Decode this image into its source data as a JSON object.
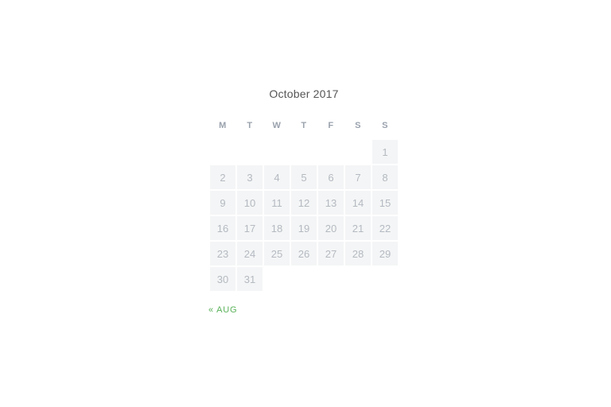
{
  "calendar": {
    "title": "October 2017",
    "weekdays": [
      "M",
      "T",
      "W",
      "T",
      "F",
      "S",
      "S"
    ],
    "grid": [
      [
        null,
        null,
        null,
        null,
        null,
        null,
        1
      ],
      [
        2,
        3,
        4,
        5,
        6,
        7,
        8
      ],
      [
        9,
        10,
        11,
        12,
        13,
        14,
        15
      ],
      [
        16,
        17,
        18,
        19,
        20,
        21,
        22
      ],
      [
        23,
        24,
        25,
        26,
        27,
        28,
        29
      ],
      [
        30,
        31,
        null,
        null,
        null,
        null,
        null
      ]
    ],
    "prev_link": "« AUG"
  }
}
